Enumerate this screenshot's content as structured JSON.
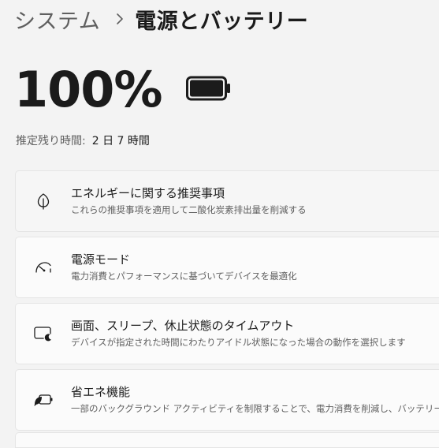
{
  "breadcrumb": {
    "root": "システム",
    "separator_icon": "chevron-right-icon",
    "current": "電源とバッテリー"
  },
  "battery": {
    "percent_text": "100%",
    "level": 1.0,
    "icon": "battery-full-icon"
  },
  "remaining": {
    "label": "推定残り時間:",
    "value": "2 日 7 時間"
  },
  "settings": [
    {
      "icon": "leaf-icon",
      "title": "エネルギーに関する推奨事項",
      "description": "これらの推奨事項を適用して二酸化炭素排出量を削減する"
    },
    {
      "icon": "power-mode-gauge-icon",
      "title": "電源モード",
      "description": "電力消費とパフォーマンスに基づいてデバイスを最適化"
    },
    {
      "icon": "screen-sleep-icon",
      "title": "画面、スリープ、休止状態のタイムアウト",
      "description": "デバイスが指定された時間にわたりアイドル状態になった場合の動作を選択します"
    },
    {
      "icon": "battery-saver-icon",
      "title": "省エネ機能",
      "description": "一部のバックグラウンド アクティビティを制限することで、電力消費を削減し、バッテリーの"
    }
  ],
  "colors": {
    "background": "#f3f3f3",
    "card": "#fbfbfb",
    "text_primary": "#1b1b1b",
    "text_secondary": "#5f5f5f"
  }
}
